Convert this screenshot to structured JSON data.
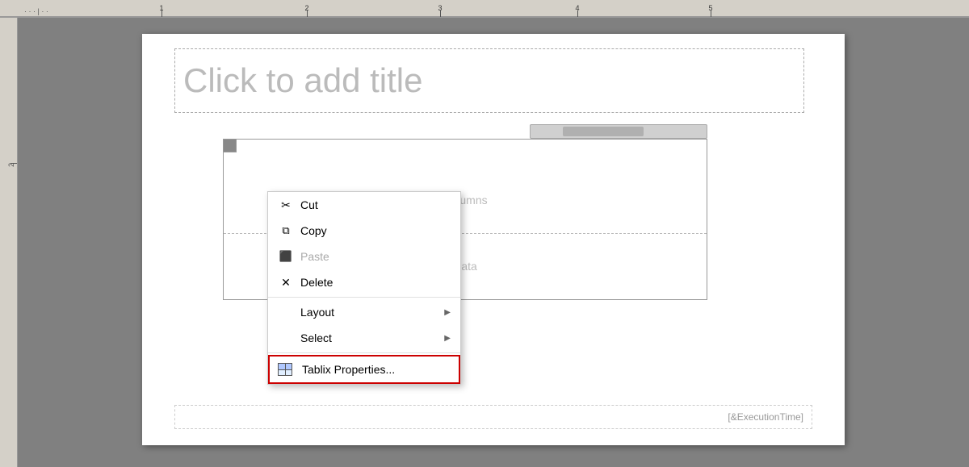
{
  "ruler": {
    "marks": [
      1,
      2,
      3,
      4,
      5
    ]
  },
  "slide": {
    "title_placeholder": "Click to add title",
    "table": {
      "columns_label": "Columns",
      "data_label": "Data"
    },
    "footer": {
      "execution_time": "[&ExecutionTime]"
    }
  },
  "context_menu": {
    "items": [
      {
        "id": "cut",
        "label": "Cut",
        "icon": "✂",
        "has_arrow": false,
        "disabled": false,
        "highlighted": false
      },
      {
        "id": "copy",
        "label": "Copy",
        "icon": "⧉",
        "has_arrow": false,
        "disabled": false,
        "highlighted": false
      },
      {
        "id": "paste",
        "label": "Paste",
        "icon": "📋",
        "has_arrow": false,
        "disabled": true,
        "highlighted": false
      },
      {
        "id": "delete",
        "label": "Delete",
        "icon": "✕",
        "has_arrow": false,
        "disabled": false,
        "highlighted": false
      },
      {
        "id": "layout",
        "label": "Layout",
        "icon": "",
        "has_arrow": true,
        "disabled": false,
        "highlighted": false
      },
      {
        "id": "select",
        "label": "Select",
        "icon": "",
        "has_arrow": true,
        "disabled": false,
        "highlighted": false
      },
      {
        "id": "tablix",
        "label": "Tablix Properties...",
        "icon": "tablix",
        "has_arrow": false,
        "disabled": false,
        "highlighted": true
      }
    ]
  },
  "colors": {
    "highlight_border": "#cc0000",
    "menu_bg": "#ffffff",
    "disabled_text": "#aaaaaa",
    "slide_bg": "#ffffff",
    "canvas_bg": "#808080"
  }
}
